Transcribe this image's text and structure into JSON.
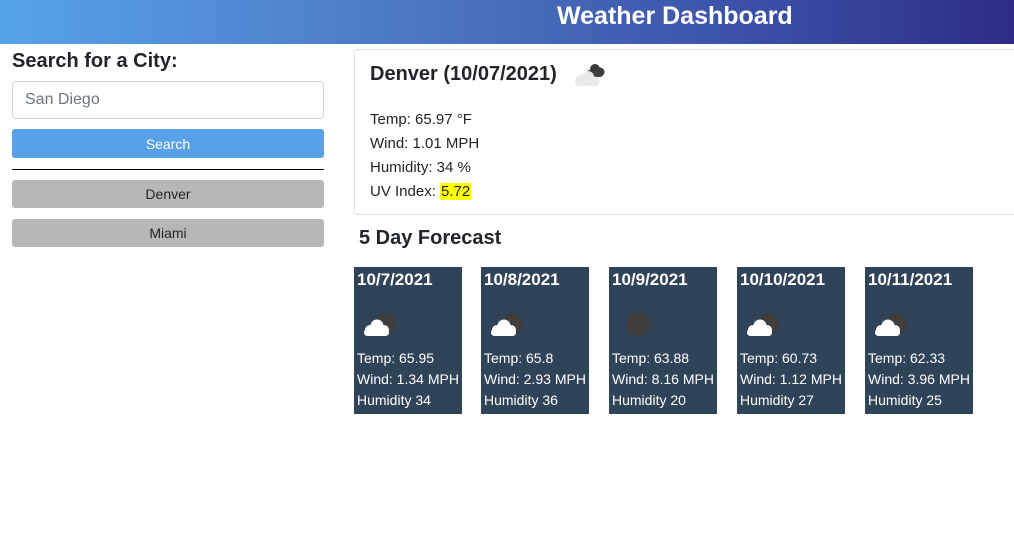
{
  "header": {
    "title": "Weather Dashboard"
  },
  "sidebar": {
    "title": "Search for a City:",
    "search_placeholder": "San Diego",
    "search_button": "Search",
    "history": [
      "Denver",
      "Miami"
    ]
  },
  "current": {
    "title": "Denver (10/07/2021)",
    "icon": "cloudy-icon",
    "temp": "Temp: 65.97 °F",
    "wind": "Wind: 1.01 MPH",
    "humidity": "Humidity: 34 %",
    "uv_label": "UV Index: ",
    "uv_value": "5.72"
  },
  "forecast": {
    "title": "5 Day Forecast",
    "days": [
      {
        "date": "10/7/2021",
        "icon": "partly-cloudy-night-icon",
        "temp": "Temp: 65.95",
        "wind": "Wind: 1.34 MPH",
        "humidity": "Humidity 34"
      },
      {
        "date": "10/8/2021",
        "icon": "partly-cloudy-night-icon",
        "temp": "Temp: 65.8",
        "wind": "Wind: 2.93 MPH",
        "humidity": "Humidity 36"
      },
      {
        "date": "10/9/2021",
        "icon": "clear-night-icon",
        "temp": "Temp: 63.88",
        "wind": "Wind: 8.16 MPH",
        "humidity": "Humidity 20"
      },
      {
        "date": "10/10/2021",
        "icon": "partly-cloudy-night-icon",
        "temp": "Temp: 60.73",
        "wind": "Wind: 1.12 MPH",
        "humidity": "Humidity 27"
      },
      {
        "date": "10/11/2021",
        "icon": "partly-cloudy-night-icon",
        "temp": "Temp: 62.33",
        "wind": "Wind: 3.96 MPH",
        "humidity": "Humidity 25"
      }
    ]
  },
  "colors": {
    "header_start": "#56a3ea",
    "header_end": "#2e2c86",
    "search_button": "#58a0e8",
    "history_button": "#b7b7b7",
    "card_bg": "#2f4458",
    "uv_highlight": "#ffff00"
  }
}
